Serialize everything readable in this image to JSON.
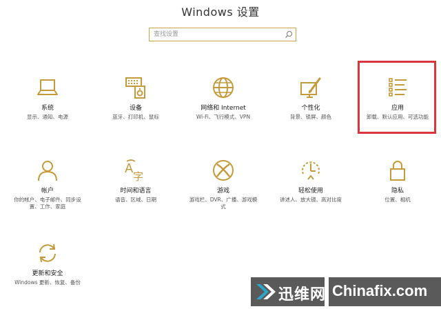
{
  "window": {
    "title": "Windows 设置"
  },
  "search": {
    "placeholder": "查找设置"
  },
  "accent_color": "#c49a3a",
  "highlight_color": "#d9363e",
  "tiles": [
    {
      "name": "系统",
      "desc": "显示、通知、电源",
      "icon": "laptop-icon"
    },
    {
      "name": "设备",
      "desc": "蓝牙、打印机、鼠标",
      "icon": "devices-icon"
    },
    {
      "name": "网络和 Internet",
      "desc": "Wi-Fi、飞行模式、VPN",
      "icon": "globe-icon"
    },
    {
      "name": "个性化",
      "desc": "背景、锁屏、颜色",
      "icon": "personalization-icon"
    },
    {
      "name": "应用",
      "desc": "卸载、默认应用、可选功能",
      "icon": "apps-list-icon"
    },
    {
      "name": "帐户",
      "desc": "你的帐户、电子邮件、同步设置、工作、家庭",
      "icon": "person-icon"
    },
    {
      "name": "时间和语言",
      "desc": "语音、区域、日期",
      "icon": "time-language-icon"
    },
    {
      "name": "游戏",
      "desc": "游戏栏、DVR、广播、游戏模式",
      "icon": "xbox-icon"
    },
    {
      "name": "轻松使用",
      "desc": "讲述人、放大镜、高对比度",
      "icon": "ease-of-access-icon"
    },
    {
      "name": "隐私",
      "desc": "位置、相机",
      "icon": "lock-icon"
    },
    {
      "name": "更新和安全",
      "desc": "Windows 更新、恢复、备份",
      "icon": "update-icon"
    }
  ],
  "watermark": {
    "cn": "迅维网",
    "en": "Chinafix.com"
  }
}
